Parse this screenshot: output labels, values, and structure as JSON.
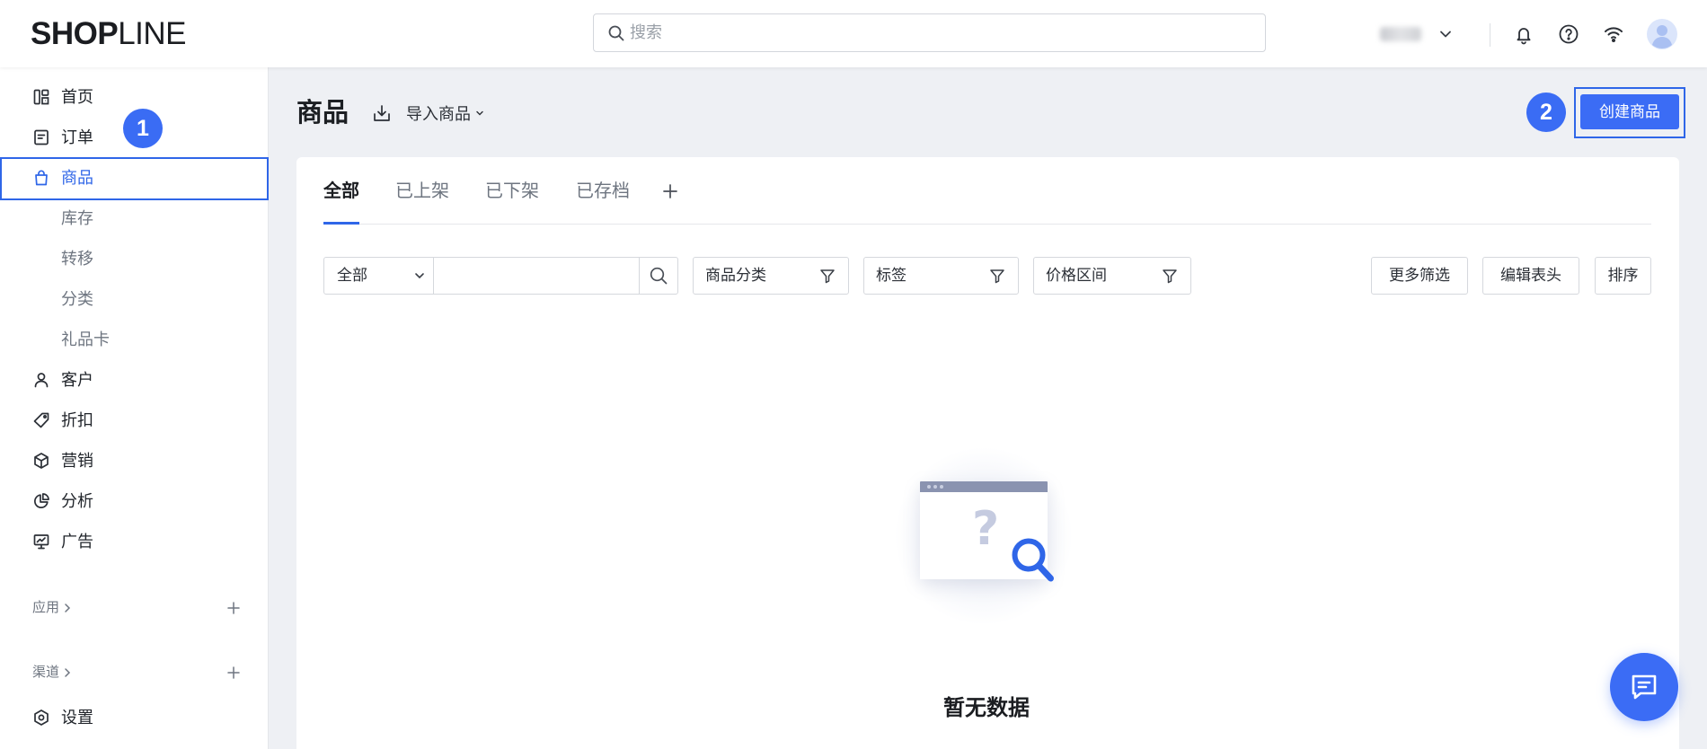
{
  "logo": {
    "part1": "SHOP",
    "part2": "LINE"
  },
  "header": {
    "search_placeholder": "搜索",
    "icons": [
      "search-icon",
      "chevron-down-icon",
      "bell-icon",
      "help-icon",
      "wifi-icon",
      "avatar-icon"
    ]
  },
  "sidebar": {
    "items": [
      {
        "label": "首页",
        "icon": "dashboard-icon"
      },
      {
        "label": "订单",
        "icon": "order-icon"
      },
      {
        "label": "商品",
        "icon": "bag-icon",
        "active": true
      },
      {
        "label": "库存"
      },
      {
        "label": "转移"
      },
      {
        "label": "分类"
      },
      {
        "label": "礼品卡"
      },
      {
        "label": "客户",
        "icon": "user-icon"
      },
      {
        "label": "折扣",
        "icon": "tag-icon"
      },
      {
        "label": "营销",
        "icon": "cube-icon"
      },
      {
        "label": "分析",
        "icon": "pie-chart-icon"
      },
      {
        "label": "广告",
        "icon": "ad-monitor-icon"
      }
    ],
    "sections": [
      {
        "label": "应用"
      },
      {
        "label": "渠道"
      }
    ],
    "settings": {
      "label": "设置",
      "icon": "settings-icon"
    }
  },
  "annotations": {
    "step1": "1",
    "step2": "2"
  },
  "page": {
    "title": "商品",
    "import_label": "导入商品",
    "create_label": "创建商品"
  },
  "tabs": [
    {
      "label": "全部",
      "active": true
    },
    {
      "label": "已上架"
    },
    {
      "label": "已下架"
    },
    {
      "label": "已存档"
    }
  ],
  "filters": {
    "scope": "全部",
    "category": "商品分类",
    "tag": "标签",
    "price": "价格区间",
    "more": "更多筛选",
    "edit_columns": "编辑表头",
    "sort": "排序"
  },
  "empty": {
    "text": "暂无数据"
  },
  "colors": {
    "primary": "#3b6cf5",
    "highlight": "#2f66e8",
    "background": "#eef0f4",
    "badge": "#3a6cf4"
  }
}
